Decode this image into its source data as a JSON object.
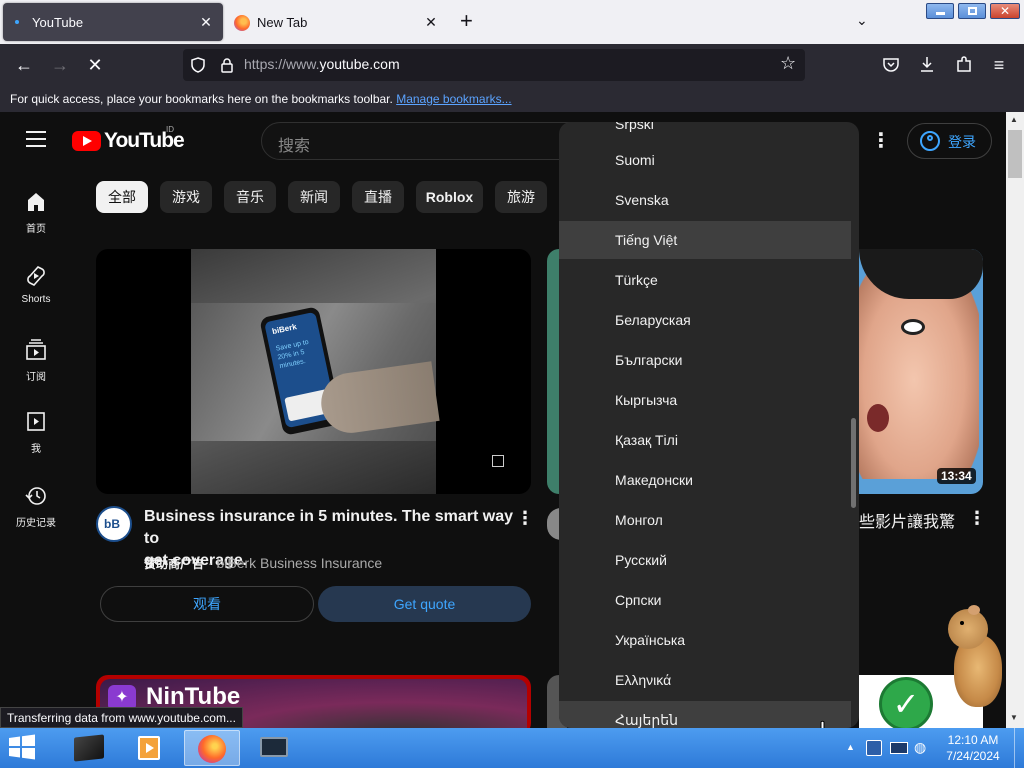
{
  "browser": {
    "tabs": [
      {
        "label": "YouTube",
        "active": true
      },
      {
        "label": "New Tab",
        "active": false
      }
    ],
    "new_tab_symbol": "+",
    "url": {
      "scheme": "https://www.",
      "host": "youtube.com"
    },
    "bookmarks_hint": "For quick access, place your bookmarks here on the bookmarks toolbar.",
    "manage_bookmarks": "Manage bookmarks...",
    "status": "Transferring data from www.youtube.com..."
  },
  "youtube": {
    "logo_text": "YouTube",
    "region": "ID",
    "search_placeholder": "搜索",
    "signin": "登录",
    "sidebar": [
      {
        "label": "首页",
        "icon": "home-icon"
      },
      {
        "label": "Shorts",
        "icon": "shorts-icon"
      },
      {
        "label": "订阅",
        "icon": "subscriptions-icon"
      },
      {
        "label": "我",
        "icon": "you-icon"
      },
      {
        "label": "历史记录",
        "icon": "history-icon"
      }
    ],
    "chips": [
      "全部",
      "游戏",
      "音乐",
      "新闻",
      "直播",
      "Roblox",
      "旅游"
    ],
    "ad": {
      "title_line1": "Business insurance in 5 minutes. The smart way to",
      "title_line2": "get coverage.",
      "sponsor": "赞助商广告",
      "separator": "·",
      "advertiser": "biBerk Business Insurance",
      "avatar_text": "bB",
      "btn_watch": "观看",
      "btn_quote": "Get quote",
      "phone_brand": "biBerk",
      "phone_text": "Save up to 20% in 5 minutes."
    },
    "video2": {
      "duration": "13:34",
      "title_partial": "些影片讓我驚"
    },
    "nintube_label": "NinTube"
  },
  "language_menu": {
    "items": [
      "Srpski",
      "Suomi",
      "Svenska",
      "Tiếng Việt",
      "Türkçe",
      "Беларуская",
      "Български",
      "Кыргызча",
      "Қазақ Тілі",
      "Македонски",
      "Монгол",
      "Русский",
      "Српски",
      "Українська",
      "Ελληνικά",
      "Հայերեն"
    ],
    "hovered": "Tiếng Việt"
  },
  "taskbar": {
    "time": "12:10 AM",
    "date": "7/24/2024"
  },
  "colors": {
    "youtube_red": "#ff0000",
    "quote_button": "#263850",
    "link_blue": "#3ea6ff"
  }
}
